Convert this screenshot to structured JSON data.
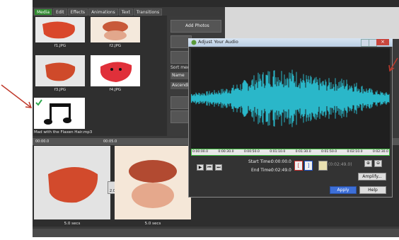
{
  "app": {
    "tabs": [
      {
        "label": "Media"
      },
      {
        "label": "Edit"
      },
      {
        "label": "Effects"
      },
      {
        "label": "Animations"
      },
      {
        "label": "Text"
      },
      {
        "label": "Transitions"
      }
    ],
    "media_items": [
      {
        "label": "f1.JPG"
      },
      {
        "label": "f2.JPG"
      },
      {
        "label": "f3.JPG"
      },
      {
        "label": "f4.JPG"
      },
      {
        "label": "Mad with the Flaxen Hair.mp3"
      }
    ],
    "side_buttons": {
      "add_photos": "Add Photos",
      "sort_label": "Sort med",
      "sort_by": "Name",
      "order": "Ascendir"
    },
    "ruler": {
      "t0": "00:00.0",
      "t1": "00:05.0"
    },
    "timeline": {
      "clip1_duration": "5.0 secs",
      "clip2_duration": "5.0 secs",
      "transition_label": "2.0"
    }
  },
  "dialog": {
    "title": "Adjust Your Audio",
    "ruler_ticks": [
      "0:00:00.0",
      "0:00:30.0",
      "0:00:50.0",
      "0:01:10.0",
      "0:01:30.0",
      "0:01:50.0",
      "0:02:10.0",
      "0:02:30.0"
    ],
    "start_time_label": "Start Time:",
    "start_time_value": "0:00:00.0",
    "end_time_label": "End Time:",
    "end_time_value": "0:02:49.0",
    "duration": "(0:02:49.0)",
    "amplify_label": "Amplify...",
    "apply_label": "Apply",
    "help_label": "Help",
    "wave_color": "#2ab7c9"
  }
}
